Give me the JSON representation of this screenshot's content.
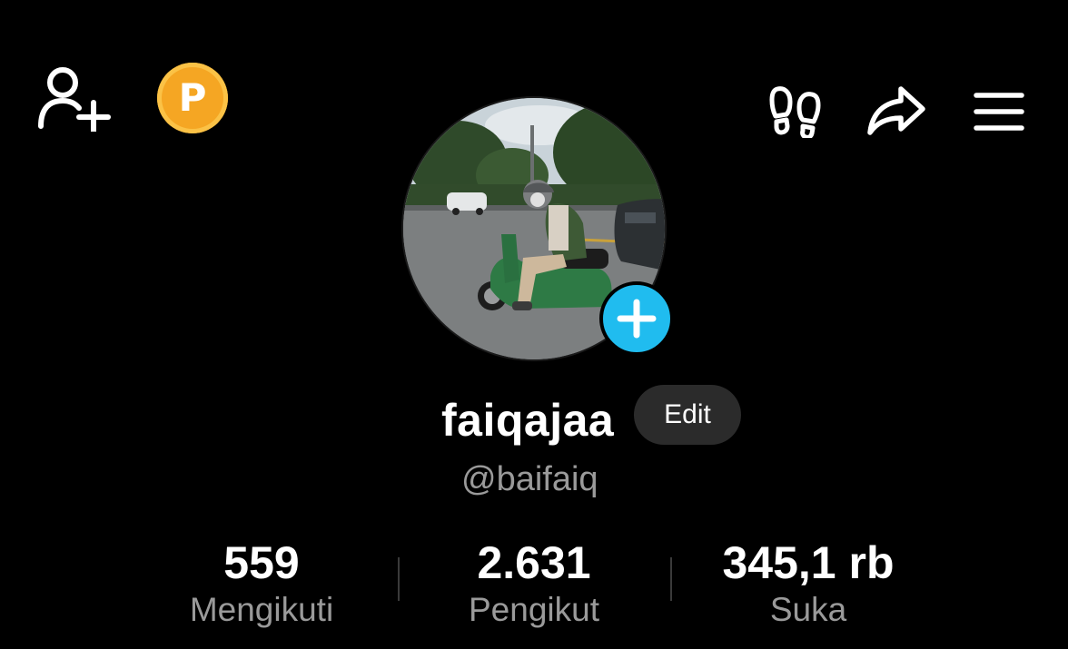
{
  "header": {
    "left_icons": [
      "add-friend-icon",
      "coin-icon"
    ],
    "coin_label": "P",
    "right_icons": [
      "footprint-icon",
      "share-icon",
      "menu-icon"
    ],
    "coin_color": "#f5a623"
  },
  "profile": {
    "display_name": "faiqajaa",
    "edit_label": "Edit",
    "handle": "@baifaiq",
    "avatar_badge_color": "#20bcef"
  },
  "stats": [
    {
      "value": "559",
      "label": "Mengikuti"
    },
    {
      "value": "2.631",
      "label": "Pengikut"
    },
    {
      "value": "345,1 rb",
      "label": "Suka"
    }
  ]
}
